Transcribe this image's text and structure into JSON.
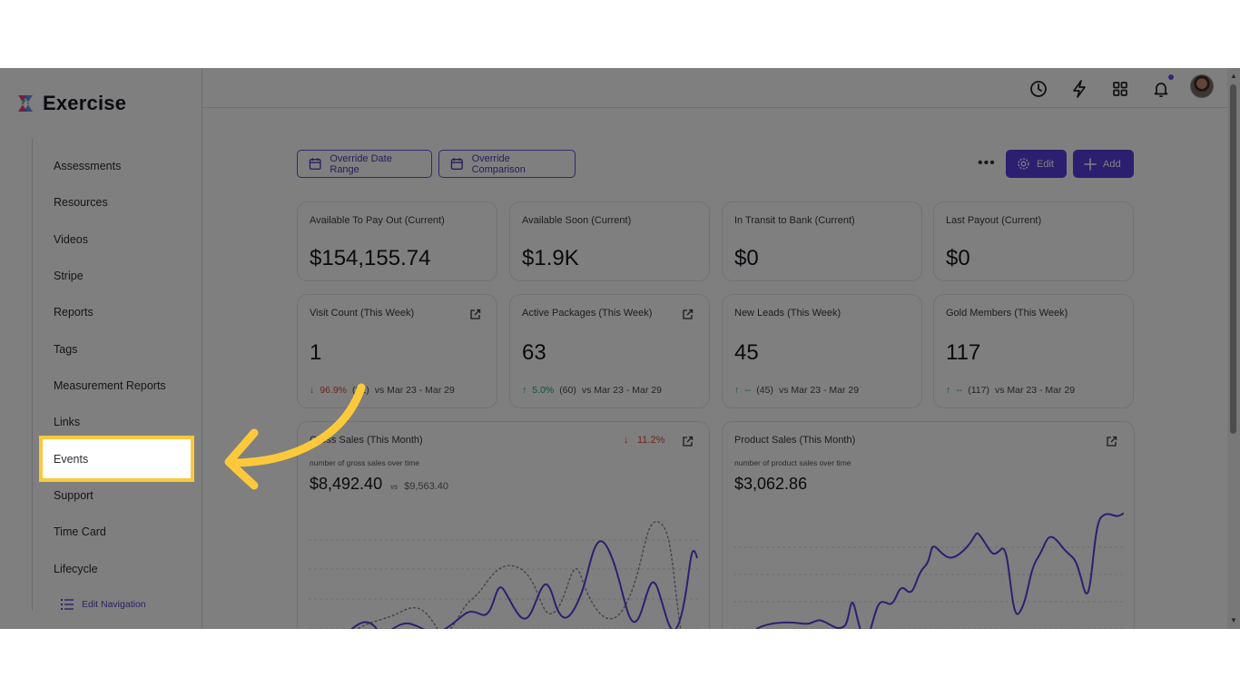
{
  "app": {
    "name": "Exercise"
  },
  "sidebar": {
    "items": [
      {
        "label": "Assessments"
      },
      {
        "label": "Resources"
      },
      {
        "label": "Videos"
      },
      {
        "label": "Stripe"
      },
      {
        "label": "Reports"
      },
      {
        "label": "Tags"
      },
      {
        "label": "Measurement Reports"
      },
      {
        "label": "Links"
      },
      {
        "label": "Events"
      },
      {
        "label": "Support"
      },
      {
        "label": "Time Card"
      },
      {
        "label": "Lifecycle"
      }
    ],
    "edit_nav_label": "Edit Navigation",
    "highlighted_item": "Events"
  },
  "topbar": {
    "icons": [
      "clock-icon",
      "lightning-icon",
      "grid-icon",
      "bell-icon",
      "avatar"
    ]
  },
  "toolbar": {
    "override_date_label": "Override Date Range",
    "override_comparison_label": "Override Comparison",
    "more_label": "•••",
    "edit_label": "Edit",
    "add_label": "Add"
  },
  "cards_row1": [
    {
      "title": "Available To Pay Out (Current)",
      "value": "$154,155.74"
    },
    {
      "title": "Available Soon (Current)",
      "value": "$1.9K"
    },
    {
      "title": "In Transit to Bank (Current)",
      "value": "$0"
    },
    {
      "title": "Last Payout (Current)",
      "value": "$0"
    }
  ],
  "cards_row2": [
    {
      "title": "Visit Count (This Week)",
      "value": "1",
      "arrow": "↓",
      "change": "96.9%",
      "prev": "(32)",
      "range": "vs Mar 23 - Mar 29"
    },
    {
      "title": "Active Packages (This Week)",
      "value": "63",
      "arrow": "↑",
      "change": "5.0%",
      "prev": "(60)",
      "range": "vs Mar 23 - Mar 29"
    },
    {
      "title": "New Leads (This Week)",
      "value": "45",
      "arrow": "↑",
      "change": "--",
      "prev": "(45)",
      "range": "vs Mar 23 - Mar 29"
    },
    {
      "title": "Gold Members (This Week)",
      "value": "117",
      "arrow": "↑",
      "change": "--",
      "prev": "(117)",
      "range": "vs Mar 23 - Mar 29"
    }
  ],
  "gross_sales": {
    "title": "Gross Sales (This Month)",
    "subtitle": "number of gross sales over time",
    "value": "$8,492.40",
    "vs_label": "vs",
    "compare_value": "$9,563.40",
    "change_arrow": "↓",
    "change": "11.2%"
  },
  "product_sales": {
    "title": "Product Sales (This Month)",
    "subtitle": "number of product sales over time",
    "value": "$3,062.86"
  },
  "colors": {
    "accent": "#5b3fe0",
    "highlight": "#fcc93b",
    "up": "#1aa37a",
    "down": "#e04b3a"
  }
}
